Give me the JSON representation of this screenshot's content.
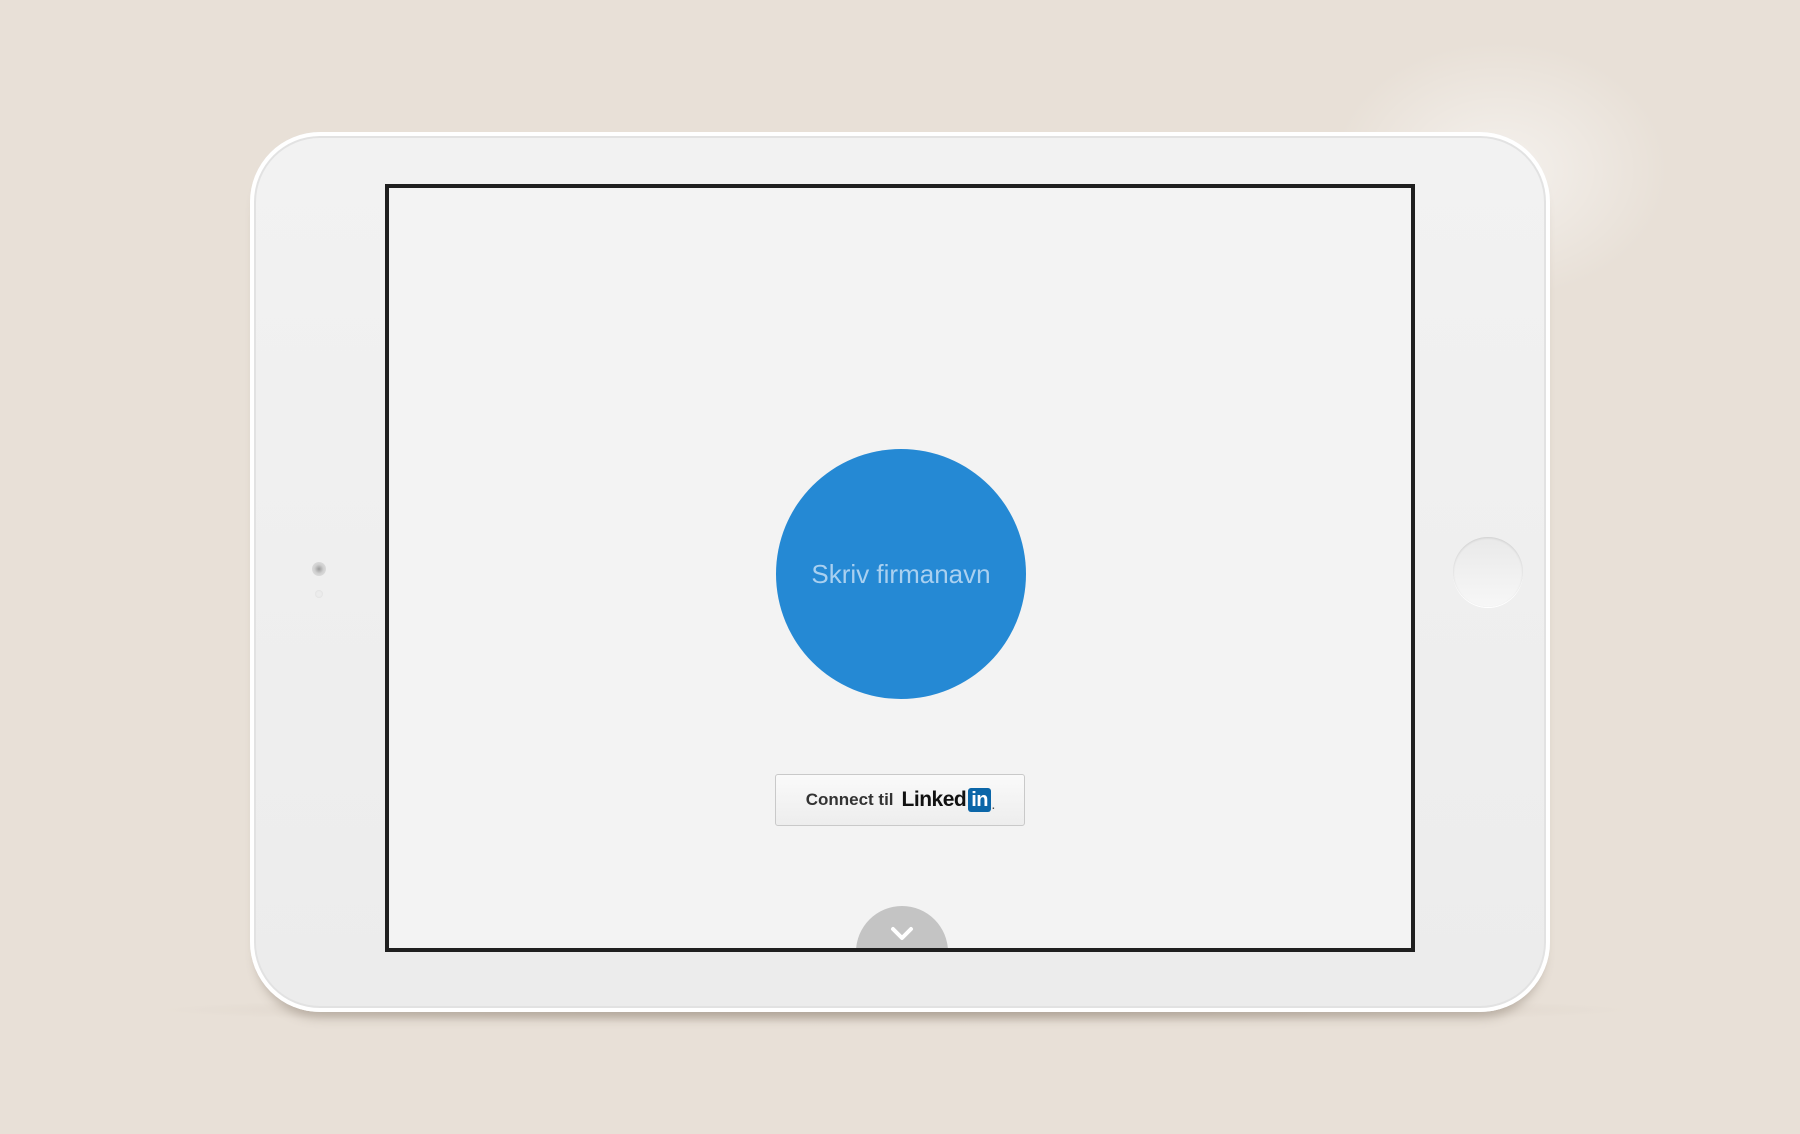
{
  "tablet": {
    "screen": {
      "company_input": {
        "placeholder": "Skriv firmanavn",
        "value": ""
      },
      "linkedin_button": {
        "connect_label": "Connect til",
        "brand_text": "Linked",
        "brand_badge": "in",
        "brand_mark": ".",
        "icon": "linkedin-logo-icon"
      },
      "scroll_button": {
        "icon": "chevron-down-icon"
      }
    }
  },
  "colors": {
    "background": "#e8e0d7",
    "circle": "#2589d4",
    "screen": "#f3f3f3",
    "linkedin_blue": "#0b66a8"
  }
}
